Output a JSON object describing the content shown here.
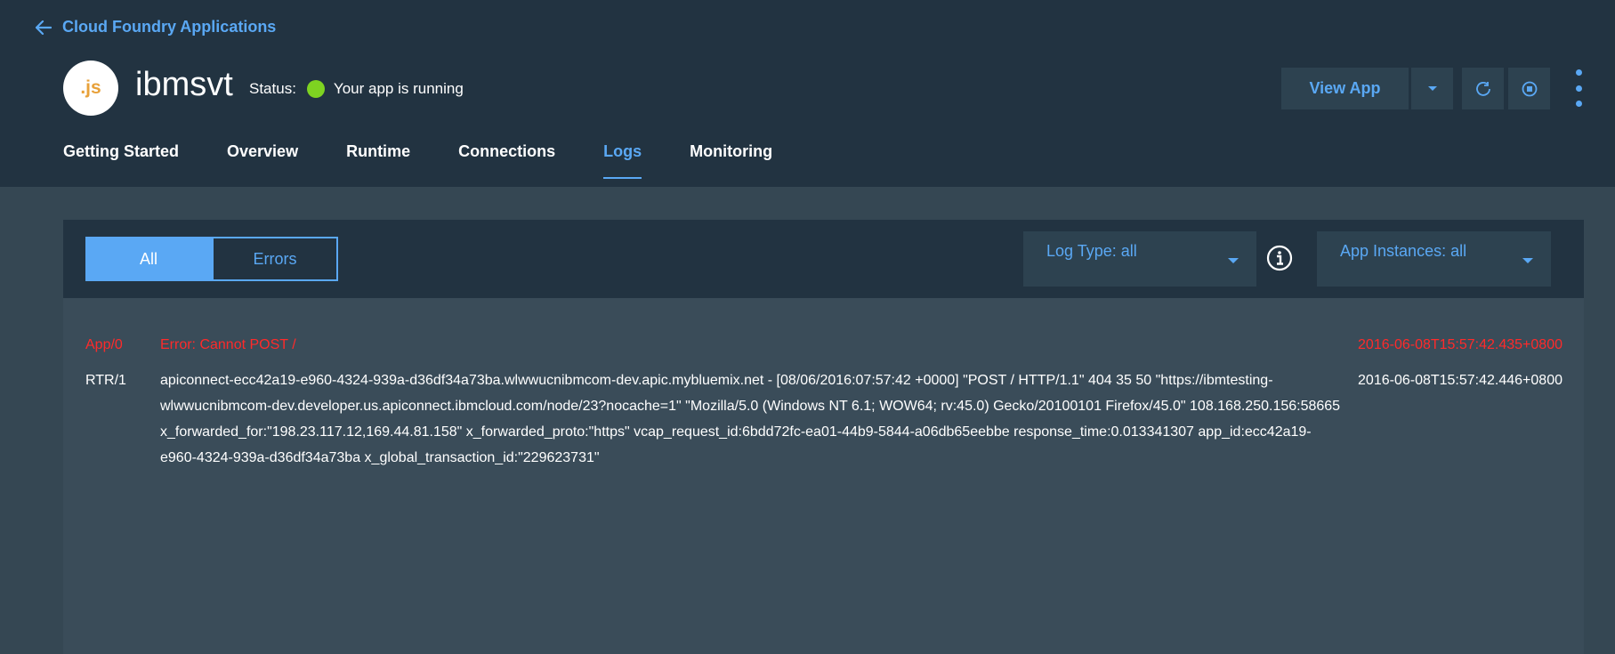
{
  "breadcrumb": {
    "back_label": "Cloud Foundry Applications"
  },
  "app": {
    "icon_text": ".js",
    "name": "ibmsvt",
    "status_label": "Status:",
    "status_text": "Your app is running",
    "status_color": "#7ed321"
  },
  "actions": {
    "view_app_label": "View App",
    "caret_icon": "caret-down-icon",
    "restart_icon": "restart-icon",
    "stop_icon": "stop-icon",
    "overflow_icon": "overflow-menu-icon"
  },
  "tabs": [
    {
      "label": "Getting Started",
      "active": false
    },
    {
      "label": "Overview",
      "active": false
    },
    {
      "label": "Runtime",
      "active": false
    },
    {
      "label": "Connections",
      "active": false
    },
    {
      "label": "Logs",
      "active": true
    },
    {
      "label": "Monitoring",
      "active": false
    }
  ],
  "filters": {
    "all_label": "All",
    "errors_label": "Errors",
    "log_type_label": "Log Type: all",
    "app_instances_label": "App Instances: all",
    "info_icon": "info-icon"
  },
  "logs": [
    {
      "source": "App/0",
      "message": "Error: Cannot POST /",
      "timestamp": "2016-06-08T15:57:42.435+0800",
      "level": "error"
    },
    {
      "source": "RTR/1",
      "message": "apiconnect-ecc42a19-e960-4324-939a-d36df34a73ba.wlwwucnibmcom-dev.apic.mybluemix.net - [08/06/2016:07:57:42 +0000] \"POST / HTTP/1.1\" 404 35 50 \"https://ibmtesting-wlwwucnibmcom-dev.developer.us.apiconnect.ibmcloud.com/node/23?nocache=1\" \"Mozilla/5.0 (Windows NT 6.1; WOW64; rv:45.0) Gecko/20100101 Firefox/45.0\" 108.168.250.156:58665 x_forwarded_for:\"198.23.117.12,169.44.81.158\" x_forwarded_proto:\"https\" vcap_request_id:6bdd72fc-ea01-44b9-5844-a06db65eebbe response_time:0.013341307 app_id:ecc42a19-e960-4324-939a-d36df34a73ba x_global_transaction_id:\"229623731\"",
      "timestamp": "2016-06-08T15:57:42.446+0800",
      "level": "info"
    }
  ],
  "colors": {
    "accent": "#5aa8f4",
    "header_bg": "#223341",
    "body_bg": "#354753",
    "error": "#ff2a2a"
  }
}
